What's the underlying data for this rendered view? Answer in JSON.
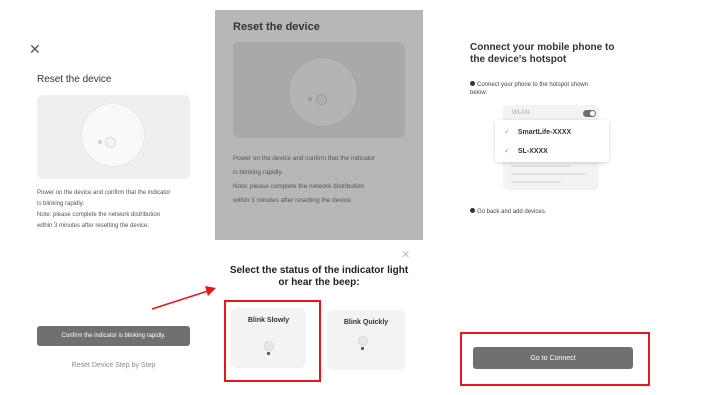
{
  "panel1": {
    "close_icon": "close-icon",
    "title": "Reset the device",
    "instructions": [
      "Power on the device and confirm that the indicator",
      "is blinking rapidly.",
      "Note: please complete the network distribution",
      "within 3 minutes after resetting the device."
    ],
    "confirm_button": "Confirm the indicator is blinking rapidly.",
    "link": "Reset Device Step by Step"
  },
  "panel2": {
    "title": "Reset the device",
    "instructions": [
      "Power on the device and confirm that the indicator",
      "is blinking rapidly.",
      "Note: please complete the network distribution",
      "within 3 minutes after resetting the device."
    ],
    "sheet": {
      "close_icon": "close-icon",
      "title_line1": "Select the status of the indicator light",
      "title_line2": "or hear the beep:",
      "options": [
        {
          "label": "Blink Slowly",
          "icon": "bulb-icon"
        },
        {
          "label": "Blink Quickly",
          "icon": "bulb-icon"
        }
      ]
    }
  },
  "panel3": {
    "title_line1": "Connect your mobile phone to",
    "title_line2": "the device's hotspot",
    "instruction_line1": "Connect your phone to the hotspot shown",
    "instruction_line2": "below:",
    "wlan_label": "WLAN",
    "networks": [
      "SmartLife-XXXX",
      "SL-XXXX"
    ],
    "go_back_text": "Go back and add devices.",
    "connect_button": "Go to Connect"
  },
  "colors": {
    "highlight": "#e8161b",
    "button_gray": "#707070",
    "overlay_gray": "#b7b7b7"
  }
}
